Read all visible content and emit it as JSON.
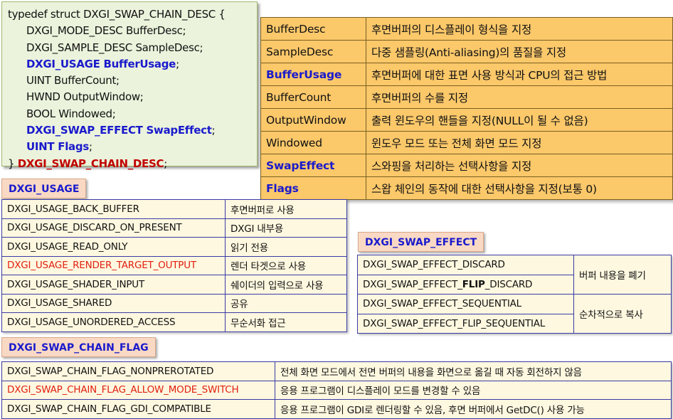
{
  "code": {
    "line0": "typedef struct DXGI_SWAP_CHAIN_DESC {",
    "lines": [
      {
        "text": "DXGI_MODE_DESC BufferDesc;"
      },
      {
        "text": "DXGI_SAMPLE_DESC SampleDesc;"
      },
      {
        "pre": "DXGI_USAGE BufferUsage",
        "post": ";"
      },
      {
        "text": "UINT BufferCount;"
      },
      {
        "text": "HWND OutputWindow;"
      },
      {
        "text": "BOOL Windowed;"
      },
      {
        "pre": "DXGI_SWAP_EFFECT SwapEffect",
        "post": ";"
      },
      {
        "pre": "UINT Flags",
        "post": ";"
      }
    ],
    "close_brace": "} ",
    "close_name": "DXGI_SWAP_CHAIN_DESC",
    "close_semicolon": ";"
  },
  "members": [
    {
      "name": "BufferDesc",
      "desc": "후면버퍼의 디스플레이 형식을 지정"
    },
    {
      "name": "SampleDesc",
      "desc": "다중 샘플링(Anti-aliasing)의 품질을 지정"
    },
    {
      "name": "BufferUsage",
      "desc": "후면버퍼에 대한 표면 사용 방식과 CPU의 접근 방법"
    },
    {
      "name": "BufferCount",
      "desc": "후면버퍼의 수를 지정"
    },
    {
      "name": "OutputWindow",
      "desc": "출력 윈도우의 핸들을 지정(NULL이 될 수 없음)"
    },
    {
      "name": "Windowed",
      "desc": "윈도우 모드 또는 전체 화면 모드 지정"
    },
    {
      "name": "SwapEffect",
      "desc": "스와핑을 처리하는 선택사항을 지정"
    },
    {
      "name": "Flags",
      "desc": "스왑 체인의 동작에 대한 선택사항을 지정(보통 0)"
    }
  ],
  "usage": {
    "label": "DXGI_USAGE",
    "rows": [
      {
        "name": "DXGI_USAGE_BACK_BUFFER",
        "desc": "후면버퍼로 사용"
      },
      {
        "name": "DXGI_USAGE_DISCARD_ON_PRESENT",
        "desc": "DXGI 내부용"
      },
      {
        "name": "DXGI_USAGE_READ_ONLY",
        "desc": "읽기 전용"
      },
      {
        "name": "DXGI_USAGE_RENDER_TARGET_OUTPUT",
        "desc": "렌더 타겟으로 사용"
      },
      {
        "name": "DXGI_USAGE_SHADER_INPUT",
        "desc": "쉐이더의 입력으로 사용"
      },
      {
        "name": "DXGI_USAGE_SHARED",
        "desc": "공유"
      },
      {
        "name": "DXGI_USAGE_UNORDERED_ACCESS",
        "desc": "무순서화 접근"
      }
    ]
  },
  "effect": {
    "label": "DXGI_SWAP_EFFECT",
    "rows": [
      {
        "name": "DXGI_SWAP_EFFECT_DISCARD"
      },
      {
        "pre": "DXGI_SWAP_EFFECT_",
        "bold": "FLIP",
        "post": "_DISCARD"
      },
      {
        "name": "DXGI_SWAP_EFFECT_SEQUENTIAL"
      },
      {
        "name": "DXGI_SWAP_EFFECT_FLIP_SEQUENTIAL"
      }
    ],
    "desc_discard": "버퍼 내용을 폐기",
    "desc_sequential": "순차적으로 복사"
  },
  "flag": {
    "label": "DXGI_SWAP_CHAIN_FLAG",
    "rows": [
      {
        "name": "DXGI_SWAP_CHAIN_FLAG_NONPREROTATED",
        "desc": "전체 화면 모드에서 전면 버퍼의 내용을 화면으로 옮길 때 자동 회전하지 않음"
      },
      {
        "name": "DXGI_SWAP_CHAIN_FLAG_ALLOW_MODE_SWITCH",
        "desc": "응용 프로그램이 디스플레이 모드를 변경할 수 있음"
      },
      {
        "name": "DXGI_SWAP_CHAIN_FLAG_GDI_COMPATIBLE",
        "desc": "응용 프로그램이 GDI로 렌더링할 수 있음, 후면 버퍼에서 GetDC() 사용 가능"
      }
    ]
  },
  "colors": {
    "highlight_blue": "#1a1acc",
    "highlight_red": "#c00000",
    "alert_red": "#e02010",
    "member_bg": "#fbc86a",
    "code_bg": "#ebf3dc",
    "table_bg": "#fff8e0",
    "label_bg": "#f9d9c4"
  }
}
